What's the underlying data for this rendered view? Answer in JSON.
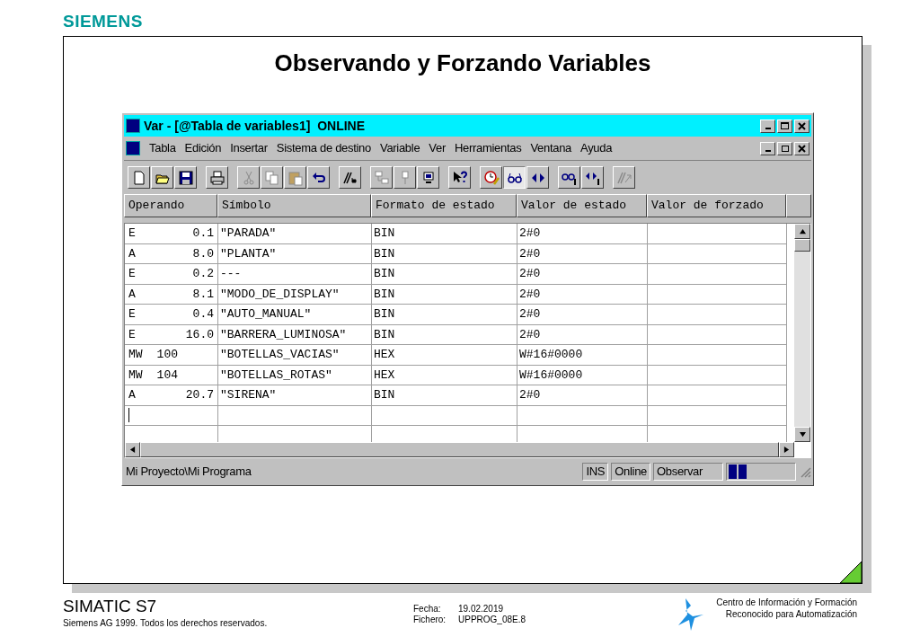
{
  "slide": {
    "brand": "SIEMENS",
    "title": "Observando y Forzando Variables"
  },
  "window": {
    "title": "Var - [@Tabla de variables1]  ONLINE"
  },
  "menu": [
    "Tabla",
    "Edición",
    "Insertar",
    "Sistema de destino",
    "Variable",
    "Ver",
    "Herramientas",
    "Ventana",
    "Ayuda"
  ],
  "toolbar": [
    {
      "kind": "new",
      "disabled": false,
      "pressed": false
    },
    {
      "kind": "open",
      "disabled": false,
      "pressed": false
    },
    {
      "kind": "save",
      "disabled": false,
      "pressed": false
    },
    {
      "kind": "sep"
    },
    {
      "kind": "print",
      "disabled": false,
      "pressed": false
    },
    {
      "kind": "sep"
    },
    {
      "kind": "cut",
      "disabled": true,
      "pressed": false
    },
    {
      "kind": "copy",
      "disabled": true,
      "pressed": false
    },
    {
      "kind": "paste",
      "disabled": true,
      "pressed": false
    },
    {
      "kind": "undo",
      "disabled": false,
      "pressed": false
    },
    {
      "kind": "sep"
    },
    {
      "kind": "rename",
      "disabled": false,
      "pressed": false
    },
    {
      "kind": "sep"
    },
    {
      "kind": "network",
      "disabled": true,
      "pressed": false
    },
    {
      "kind": "device",
      "disabled": true,
      "pressed": false
    },
    {
      "kind": "monitor",
      "disabled": false,
      "pressed": false
    },
    {
      "kind": "sep"
    },
    {
      "kind": "help",
      "disabled": false,
      "pressed": false
    },
    {
      "kind": "sep"
    },
    {
      "kind": "trigger",
      "disabled": false,
      "pressed": false
    },
    {
      "kind": "observe",
      "disabled": false,
      "pressed": true
    },
    {
      "kind": "modify",
      "disabled": false,
      "pressed": false
    },
    {
      "kind": "sep"
    },
    {
      "kind": "observe-once",
      "disabled": false,
      "pressed": false
    },
    {
      "kind": "modify-once",
      "disabled": false,
      "pressed": false
    },
    {
      "kind": "sep"
    },
    {
      "kind": "force",
      "disabled": true,
      "pressed": false
    }
  ],
  "table": {
    "columns": [
      "Operando",
      "Símbolo",
      "Formato de estado",
      "Valor de estado",
      "Valor de forzado"
    ],
    "rows": [
      {
        "area": "E",
        "address": "0.1",
        "symbol": "\"PARADA\"",
        "format": "BIN",
        "value": "2#0"
      },
      {
        "area": "A",
        "address": "8.0",
        "symbol": "\"PLANTA\"",
        "format": "BIN",
        "value": "2#0"
      },
      {
        "area": "E",
        "address": "0.2",
        "symbol": "---",
        "format": "BIN",
        "value": "2#0"
      },
      {
        "area": "A",
        "address": "8.1",
        "symbol": "\"MODO_DE_DISPLAY\"",
        "format": "BIN",
        "value": "2#0"
      },
      {
        "area": "E",
        "address": "0.4",
        "symbol": "\"AUTO_MANUAL\"",
        "format": "BIN",
        "value": "2#0"
      },
      {
        "area": "E",
        "address": "16.0",
        "symbol": "\"BARRERA_LUMINOSA\"",
        "format": "BIN",
        "value": "2#0"
      },
      {
        "area": "MW",
        "address": "100",
        "symbol": "\"BOTELLAS_VACIAS\"",
        "format": "HEX",
        "value": "W#16#0000"
      },
      {
        "area": "MW",
        "address": "104",
        "symbol": "\"BOTELLAS_ROTAS\"",
        "format": "HEX",
        "value": "W#16#0000"
      },
      {
        "area": "A",
        "address": "20.7",
        "symbol": "\"SIRENA\"",
        "format": "BIN",
        "value": "2#0"
      }
    ]
  },
  "status_bar": {
    "path": "Mi Proyecto\\Mi Programa",
    "fields": [
      "INS",
      "Online",
      "Observar"
    ]
  },
  "footer": {
    "product": "SIMATIC S7",
    "copyright": "Siemens AG 1999. Todos los derechos reservados.",
    "date_label": "Fecha:",
    "date": "19.02.2019",
    "file_label": "Fichero:",
    "file": "UPPROG_08E.8",
    "center_lines": [
      "Centro de Información y Formación",
      "Reconocido para Automatización"
    ]
  }
}
